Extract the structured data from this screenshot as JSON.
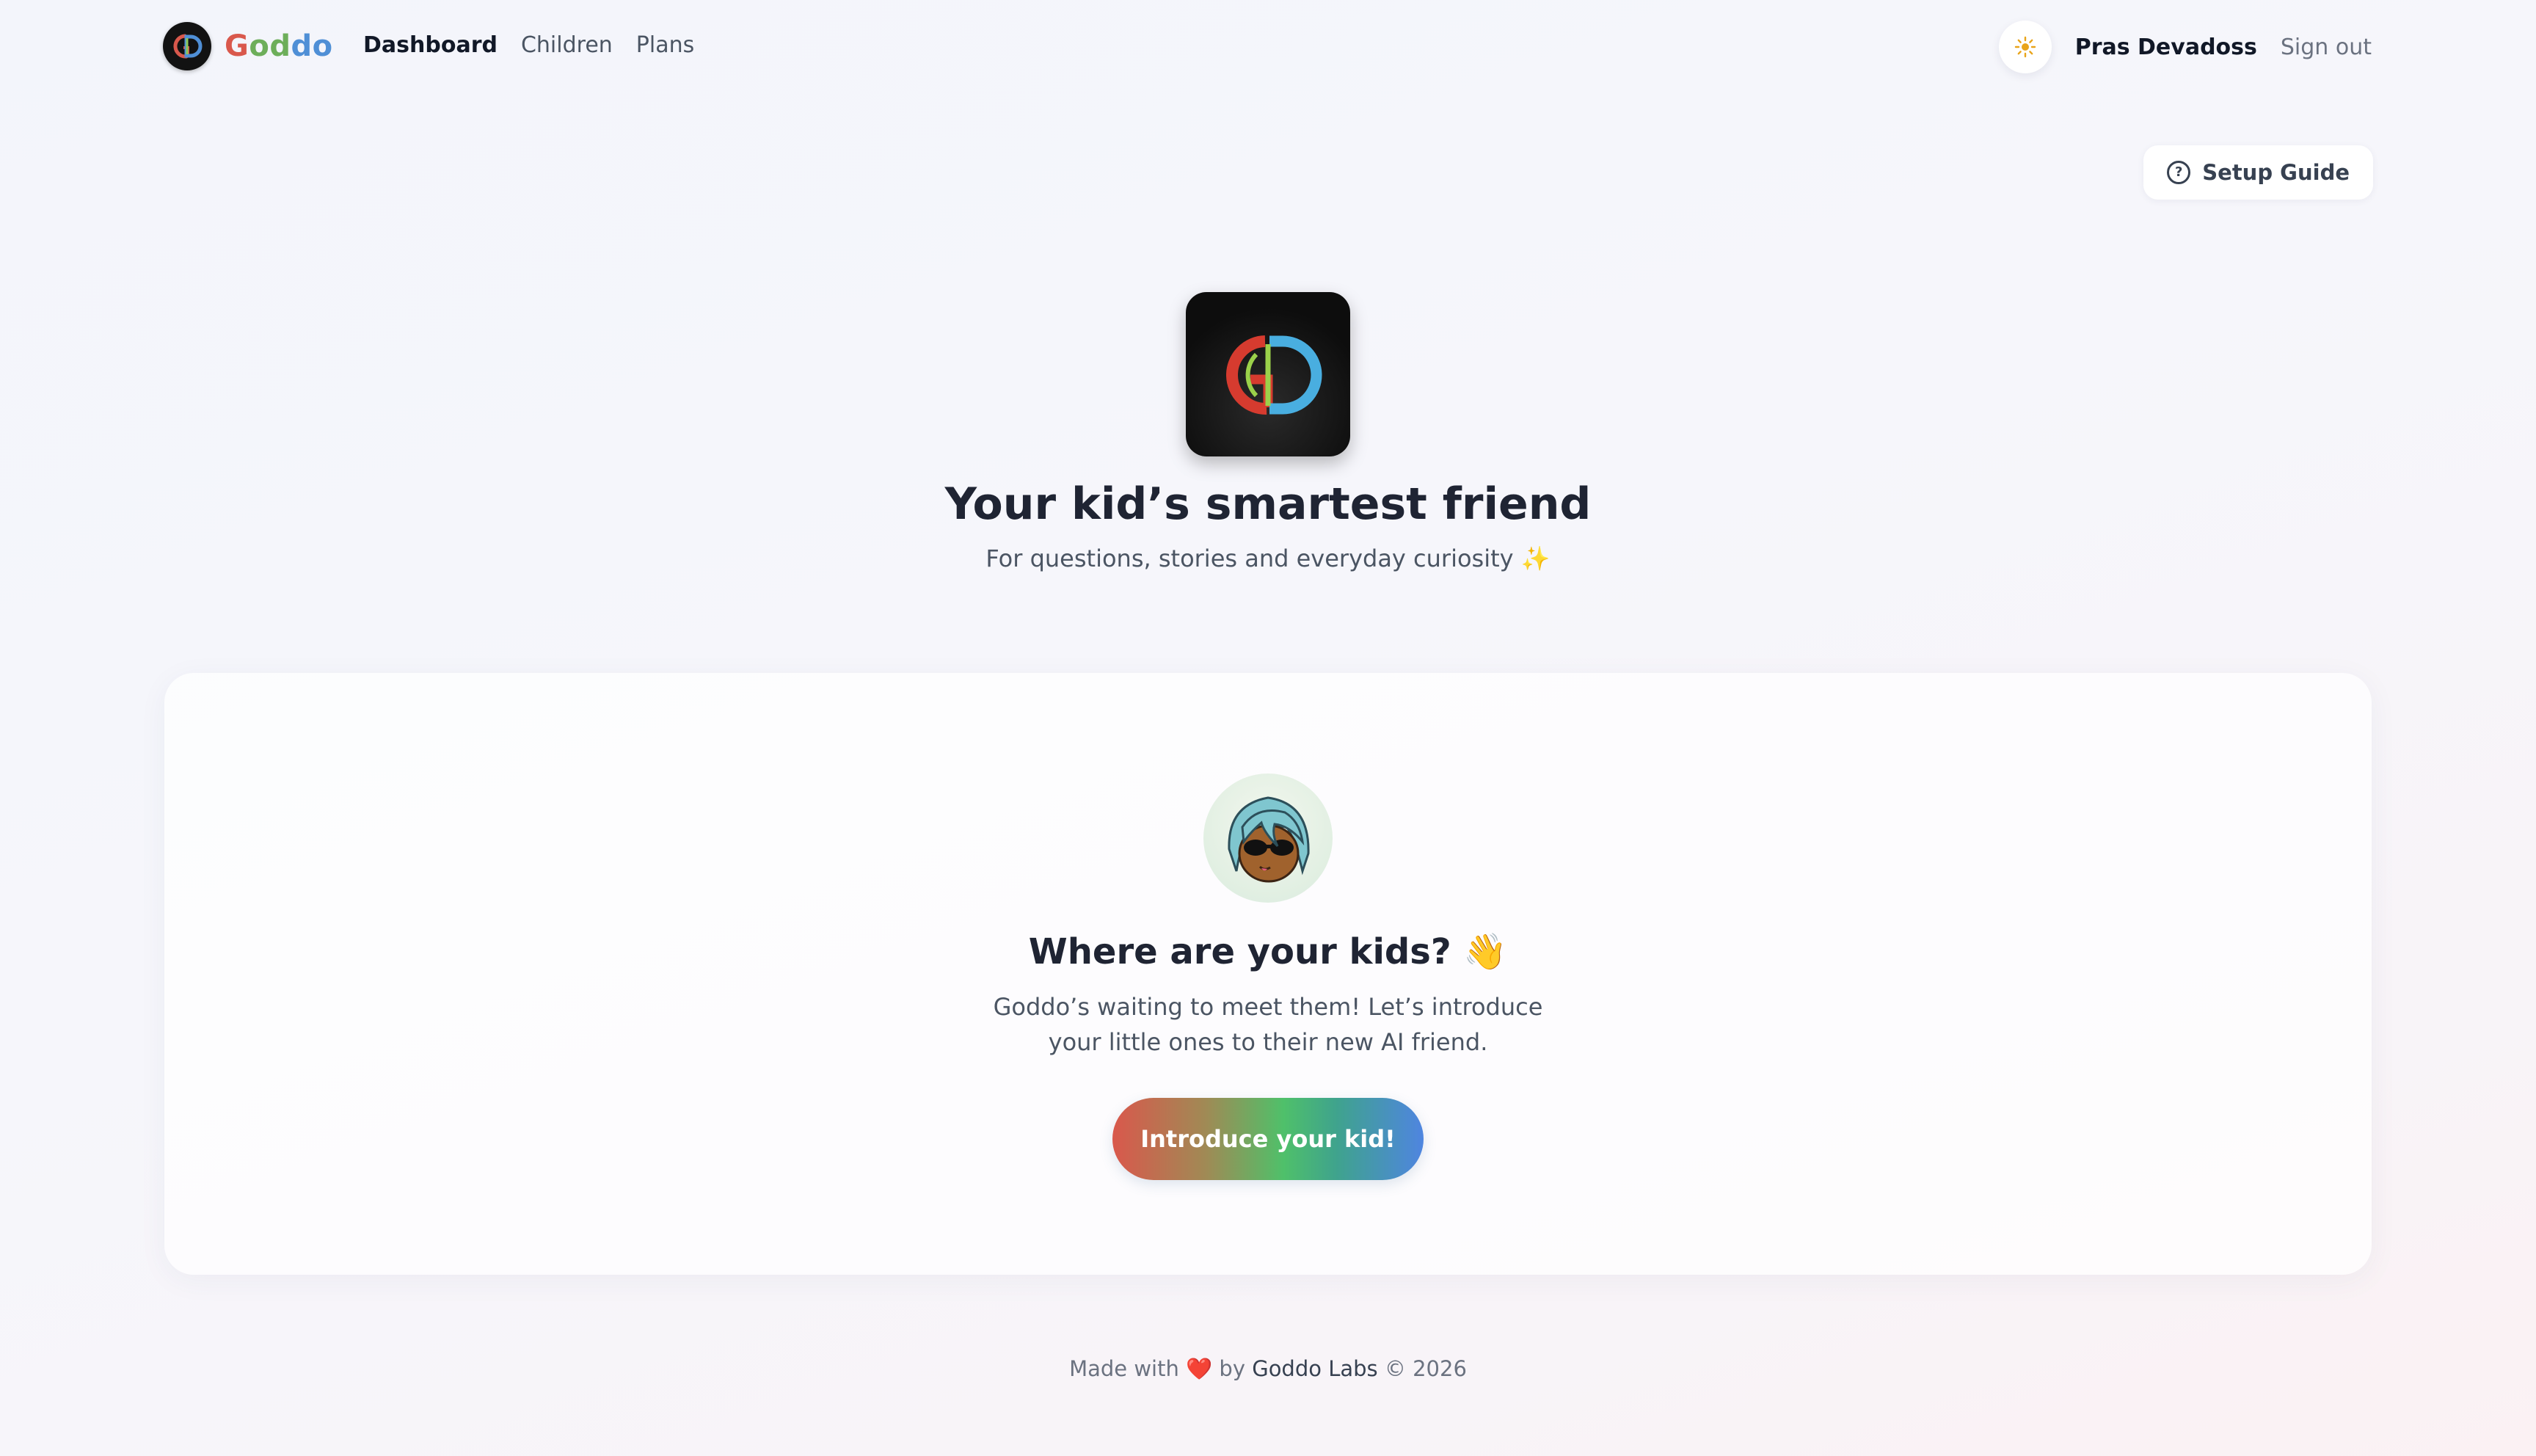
{
  "header": {
    "brand": {
      "name": "Goddo",
      "parts": [
        "G",
        "od",
        "do"
      ]
    },
    "nav": [
      {
        "label": "Dashboard",
        "active": true
      },
      {
        "label": "Children",
        "active": false
      },
      {
        "label": "Plans",
        "active": false
      }
    ],
    "theme_icon": "sun-icon",
    "user_name": "Pras Devadoss",
    "sign_out_label": "Sign out"
  },
  "setup_guide": {
    "label": "Setup Guide",
    "icon": "help-circle-icon"
  },
  "hero": {
    "title": "Your kid’s smartest friend",
    "subtitle": "For questions, stories and everyday curiosity ✨"
  },
  "empty_state": {
    "title": "Where are your kids? 👋",
    "description": "Goddo’s waiting to meet them! Let’s introduce your little ones to their new AI friend.",
    "button_label": "Introduce your kid!"
  },
  "footer": {
    "prefix": "Made with",
    "heart": "❤️",
    "by": "by",
    "company": "Goddo Labs",
    "copyright": "© 2026"
  },
  "colors": {
    "brand_red": "#d9584c",
    "brand_green": "#6dae5a",
    "brand_blue": "#4f8fd6",
    "text_dark": "#1f2433",
    "text_muted": "#4b5563"
  }
}
